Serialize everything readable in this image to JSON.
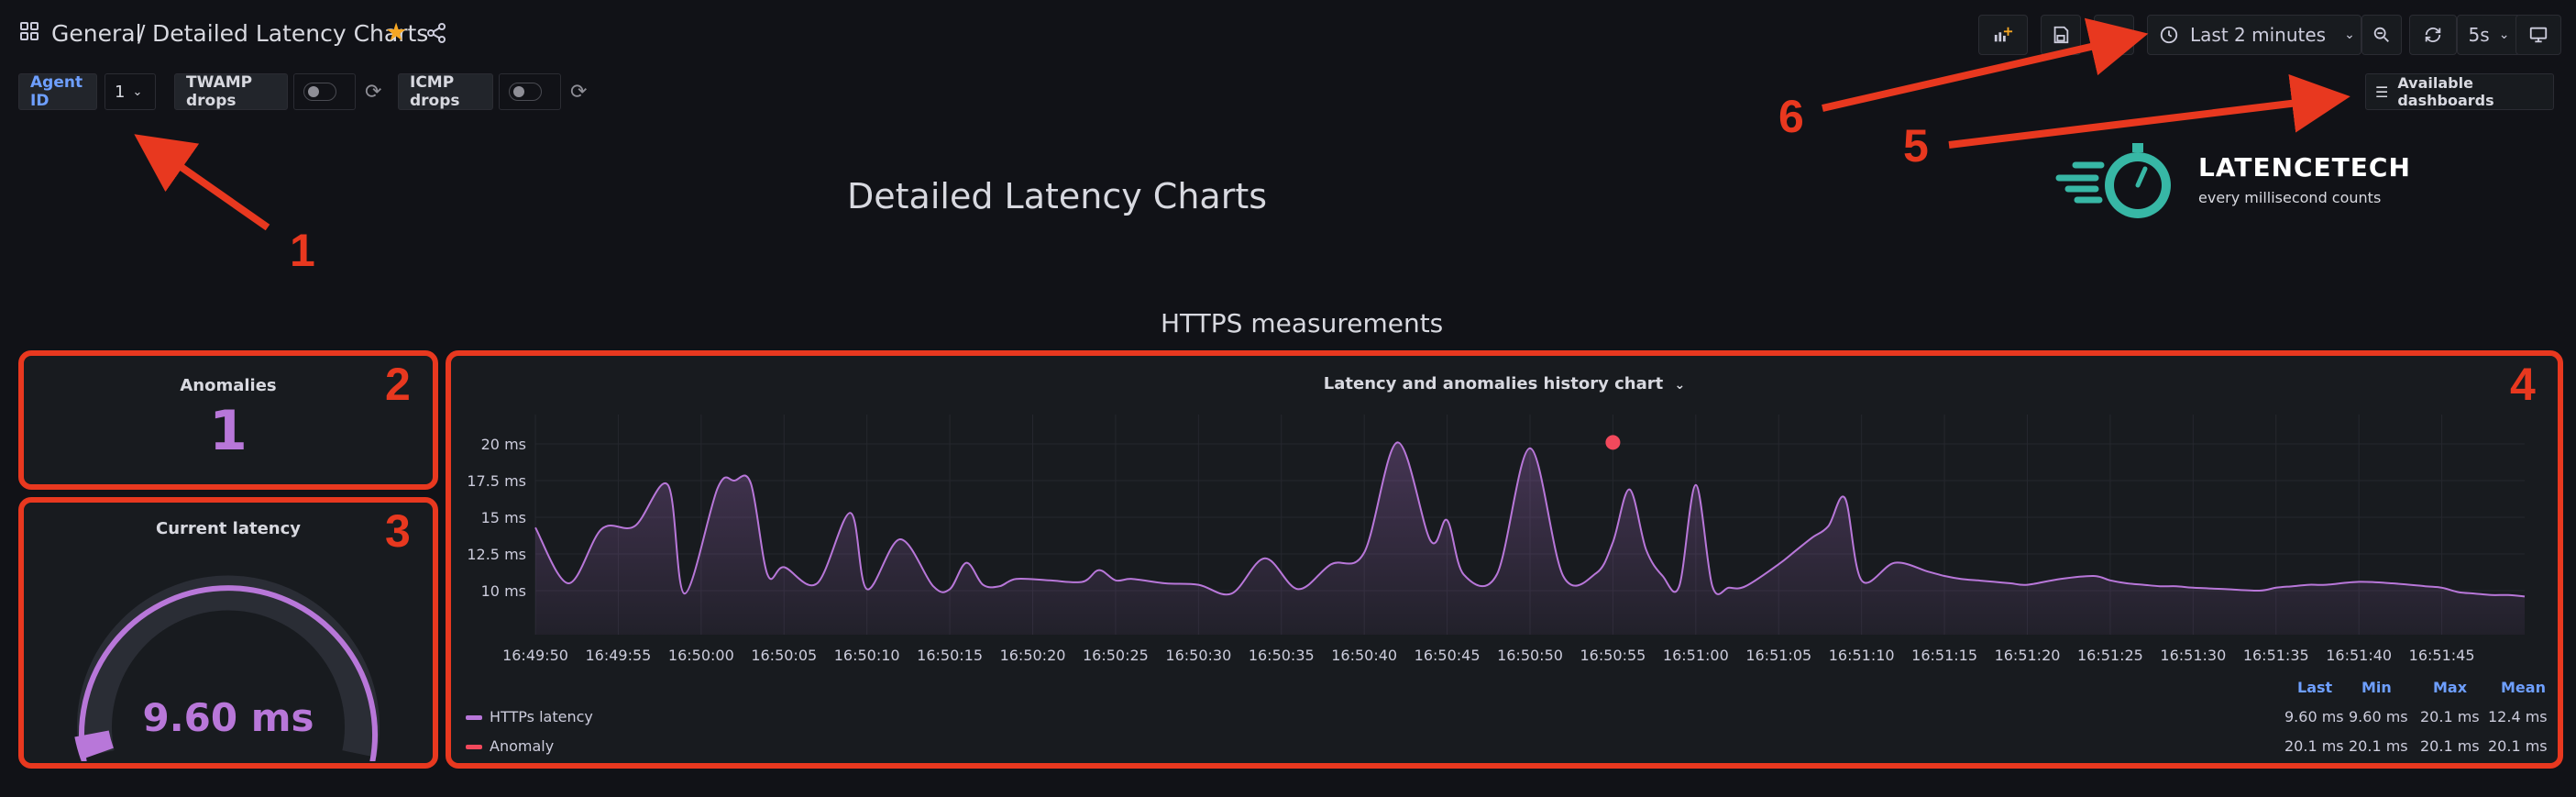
{
  "breadcrumb": {
    "root": "General",
    "separator": "/",
    "current": "Detailed Latency Charts"
  },
  "toolbar": {
    "time_range": "Last 2 minutes",
    "refresh_interval": "5s",
    "available_dashboards": "Available dashboards"
  },
  "variables": {
    "agent_id_label": "Agent ID",
    "agent_id_value": "1",
    "twamp_label": "TWAMP drops",
    "icmp_label": "ICMP drops"
  },
  "header": {
    "title": "Detailed Latency Charts"
  },
  "logo": {
    "brand": "LATENCETECH",
    "tagline": "every millisecond counts"
  },
  "section": {
    "title": "HTTPS measurements"
  },
  "anomalies_panel": {
    "title": "Anomalies",
    "value": "1",
    "color": "#b877d9"
  },
  "latency_panel": {
    "title": "Current latency",
    "value": "9.60 ms",
    "color": "#b877d9"
  },
  "annotations": {
    "a1": "1",
    "a2": "2",
    "a3": "3",
    "a4": "4",
    "a5": "5",
    "a6": "6"
  },
  "history_panel": {
    "title": "Latency and anomalies history chart",
    "legend_headers": [
      "Last",
      "Min",
      "Max",
      "Mean"
    ],
    "legend": [
      {
        "name": "HTTPs latency",
        "color": "#b877d9",
        "last": "9.60 ms",
        "min": "9.60 ms",
        "max": "20.1 ms",
        "mean": "12.4 ms"
      },
      {
        "name": "Anomaly",
        "color": "#f2495c",
        "last": "20.1 ms",
        "min": "20.1 ms",
        "max": "20.1 ms",
        "mean": "20.1 ms"
      }
    ]
  },
  "chart_data": {
    "type": "area",
    "title": "Latency and anomalies history chart",
    "ylabel": "",
    "xlabel": "",
    "y_ticks": [
      "10 ms",
      "12.5 ms",
      "15 ms",
      "17.5 ms",
      "20 ms"
    ],
    "x_ticks": [
      "16:49:50",
      "16:49:55",
      "16:50:00",
      "16:50:05",
      "16:50:10",
      "16:50:15",
      "16:50:20",
      "16:50:25",
      "16:50:30",
      "16:50:35",
      "16:50:40",
      "16:50:45",
      "16:50:50",
      "16:50:55",
      "16:51:00",
      "16:51:05",
      "16:51:10",
      "16:51:15",
      "16:51:20",
      "16:51:25",
      "16:51:30",
      "16:51:35",
      "16:51:40",
      "16:51:45"
    ],
    "ylim": [
      7,
      22
    ],
    "grid": true,
    "series": [
      {
        "name": "HTTPs latency",
        "color": "#b877d9",
        "t": [
          0,
          2,
          4,
          6,
          8,
          9,
          11,
          12,
          13,
          14,
          15,
          17,
          19,
          20,
          22,
          24,
          25,
          26,
          27,
          28,
          29,
          31,
          33,
          34,
          35,
          36,
          38,
          40,
          42,
          44,
          46,
          48,
          50,
          52,
          54,
          55,
          56,
          58,
          60,
          62,
          64,
          65,
          66,
          67,
          68,
          69,
          70,
          71,
          72,
          73,
          75,
          76,
          77,
          78,
          79,
          80,
          82,
          84,
          85,
          86,
          87,
          88,
          89,
          90,
          92,
          94,
          95,
          96,
          97,
          98,
          99,
          100,
          102,
          104,
          105,
          106,
          107,
          108,
          110,
          112,
          114,
          115,
          116,
          117,
          118,
          119,
          120
        ],
        "y": [
          14.3,
          10.5,
          14.2,
          14.4,
          17.2,
          9.8,
          17.0,
          17.5,
          17.3,
          11.1,
          11.6,
          10.5,
          15.3,
          10.1,
          13.5,
          10.3,
          10.1,
          11.9,
          10.4,
          10.3,
          10.8,
          10.7,
          10.6,
          11.4,
          10.7,
          10.8,
          10.5,
          10.4,
          9.8,
          12.2,
          10.1,
          11.8,
          12.6,
          20.1,
          13.4,
          14.8,
          11.1,
          11.1,
          19.7,
          11.0,
          11.2,
          13.3,
          16.9,
          12.8,
          11.0,
          10.3,
          17.2,
          10.3,
          10.2,
          10.3,
          11.8,
          12.7,
          13.6,
          14.4,
          16.3,
          10.7,
          11.9,
          11.3,
          11.0,
          10.8,
          10.7,
          10.6,
          10.5,
          10.4,
          10.8,
          11.0,
          10.7,
          10.5,
          10.4,
          10.3,
          10.3,
          10.2,
          10.1,
          10.0,
          10.2,
          10.3,
          10.4,
          10.4,
          10.6,
          10.5,
          10.3,
          10.2,
          9.9,
          9.8,
          9.7,
          9.7,
          9.6
        ]
      },
      {
        "name": "Anomaly",
        "color": "#f2495c",
        "t": [
          65
        ],
        "y": [
          20.1
        ]
      }
    ]
  }
}
